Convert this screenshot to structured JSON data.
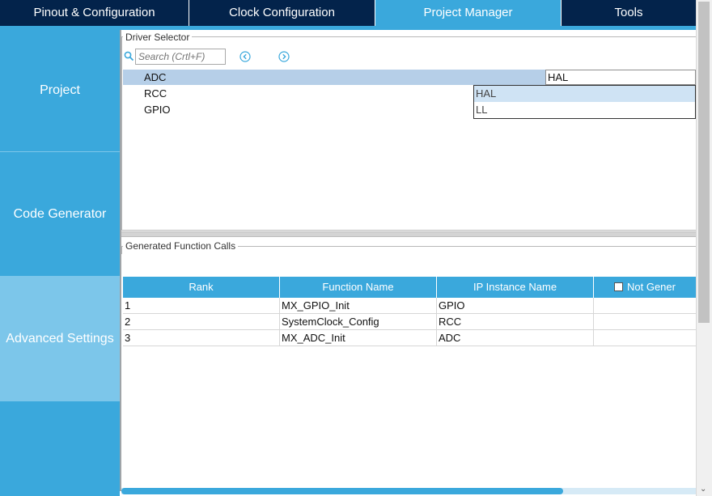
{
  "tabs": [
    {
      "label": "Pinout & Configuration"
    },
    {
      "label": "Clock Configuration"
    },
    {
      "label": "Project Manager"
    },
    {
      "label": "Tools"
    }
  ],
  "active_tab": "Project Manager",
  "sidebar": {
    "items": [
      {
        "label": "Project"
      },
      {
        "label": "Code Generator"
      },
      {
        "label": "Advanced Settings"
      }
    ],
    "active": "Advanced Settings"
  },
  "driver_selector": {
    "legend": "Driver Selector",
    "search_placeholder": "Search (Crtl+F)",
    "rows": [
      {
        "name": "ADC",
        "value": "HAL"
      },
      {
        "name": "RCC",
        "value": ""
      },
      {
        "name": "GPIO",
        "value": ""
      }
    ],
    "dropdown_options": [
      "HAL",
      "LL"
    ]
  },
  "generated_calls": {
    "legend": "Generated Function Calls",
    "columns": [
      "Rank",
      "Function Name",
      "IP Instance Name",
      "Not Gener"
    ],
    "rows": [
      {
        "rank": "1",
        "function": "MX_GPIO_Init",
        "instance": "GPIO"
      },
      {
        "rank": "2",
        "function": "SystemClock_Config",
        "instance": "RCC"
      },
      {
        "rank": "3",
        "function": "MX_ADC_Init",
        "instance": "ADC"
      }
    ]
  },
  "colors": {
    "tab_bar": "#03234b",
    "accent": "#3aa8dc",
    "sidebar_active": "#7cc6ea",
    "row_selected": "#b6cfe8"
  },
  "icons": {
    "search": "search-icon",
    "previous": "chevron-left-circle-icon",
    "next": "chevron-right-circle-icon",
    "scroll_down": "chevron-down-icon"
  }
}
